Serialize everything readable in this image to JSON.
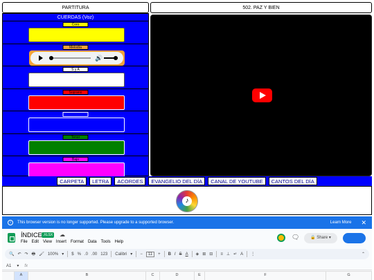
{
  "header": {
    "left_title": "PARTITURA",
    "right_title": "502. PAZ Y BIEN"
  },
  "panel": {
    "title": "CUERDAS (Voz)",
    "voices": [
      {
        "label": "Coro",
        "tab_color": "#ffff00",
        "box_color": "#ffff00"
      },
      {
        "label": "Melodía",
        "tab_color": "#f1a23a",
        "box_color": "#f1a23a",
        "is_player": true
      },
      {
        "label": "S y A",
        "tab_color": "#ffffff",
        "box_color": "#ffffff"
      },
      {
        "label": "Soprano",
        "tab_color": "#ff0000",
        "box_color": "#ff0000"
      },
      {
        "label": "",
        "tab_color": "#0000ff",
        "box_color": "#0000ff"
      },
      {
        "label": "Tenor",
        "tab_color": "#008000",
        "box_color": "#008000"
      },
      {
        "label": "Bajo",
        "tab_color": "#ff00ff",
        "box_color": "#ff00ff"
      }
    ]
  },
  "nav": {
    "links": [
      "CARPETA",
      "LETRA",
      "ACORDES",
      "EVANGELIO DEL DÍA",
      "CANAL DE YOUTUBE",
      "CANTOS DEL DÍA"
    ]
  },
  "sheets": {
    "banner_text": "This browser version is no longer supported. Please upgrade to a supported browser.",
    "learn_more": "Learn More",
    "doc_title": "ÍNDICE",
    "badge": ".XLSX",
    "menu": [
      "File",
      "Edit",
      "View",
      "Insert",
      "Format",
      "Data",
      "Tools",
      "Help"
    ],
    "share_label": "Share",
    "zoom": "100%",
    "font": "Calibri",
    "font_size": "11",
    "cell_ref": "A1",
    "columns": [
      "A",
      "B",
      "C",
      "D",
      "E",
      "F",
      "G"
    ]
  },
  "colors": {
    "panel_blue": "#0000ff",
    "sheets_blue": "#1a73e8",
    "youtube_red": "#ff0000"
  }
}
